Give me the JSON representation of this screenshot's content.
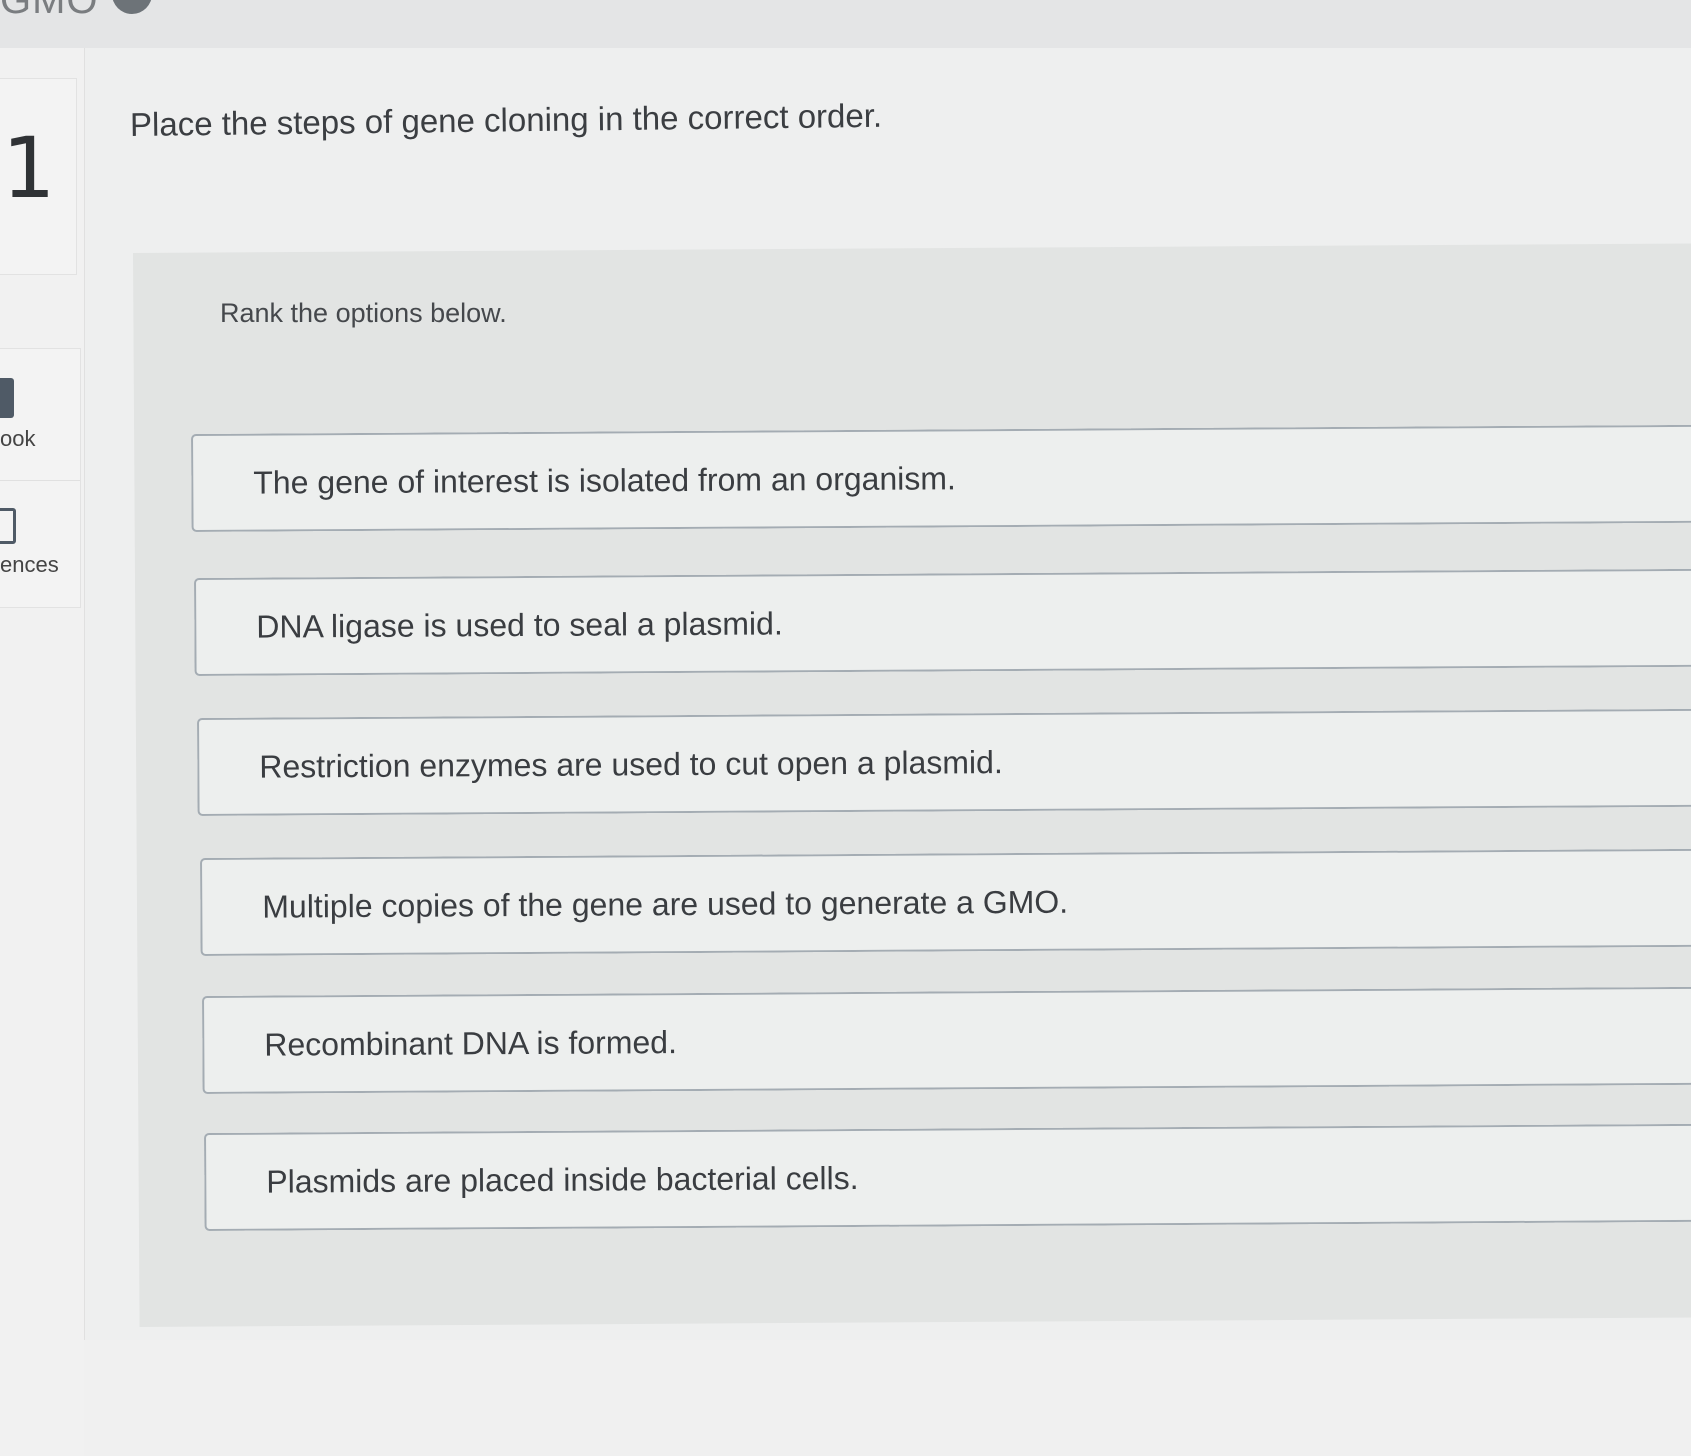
{
  "header": {
    "partial_text": "GMO"
  },
  "sidebar": {
    "question_number": "1",
    "tools": [
      {
        "label": "ook",
        "icon": "book-icon"
      },
      {
        "label": "ences",
        "icon": "clipboard-icon"
      }
    ]
  },
  "question": {
    "prompt": "Place the steps of gene cloning in the correct order.",
    "instruction": "Rank the options below."
  },
  "options": [
    {
      "text": "The gene of interest is isolated from an organism."
    },
    {
      "text": "DNA ligase is used to seal a plasmid."
    },
    {
      "text": "Restriction enzymes are used to cut open a plasmid."
    },
    {
      "text": "Multiple copies of the gene are used to generate a GMO."
    },
    {
      "text": "Recombinant DNA is formed."
    },
    {
      "text": "Plasmids are placed inside bacterial cells."
    }
  ]
}
